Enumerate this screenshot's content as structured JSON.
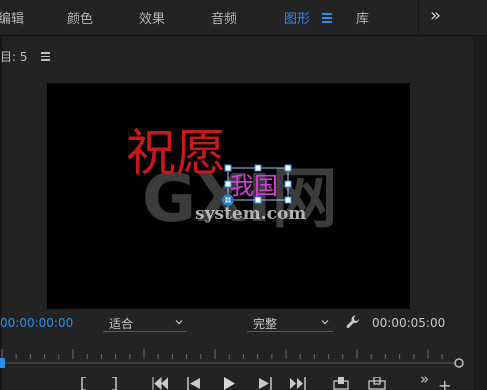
{
  "workspace_tabs": [
    {
      "label": "编辑",
      "active": false
    },
    {
      "label": "颜色",
      "active": false
    },
    {
      "label": "效果",
      "active": false
    },
    {
      "label": "音频",
      "active": false
    },
    {
      "label": "图形",
      "active": true
    },
    {
      "label": "库",
      "active": false
    }
  ],
  "panel": {
    "title": "目: 5"
  },
  "video": {
    "main_text": "祝愿",
    "sub_text": "我国",
    "watermark_logo": "GXI网",
    "watermark_text": "system.com"
  },
  "controls": {
    "current_timecode": "00:00:00:00",
    "fit_value": "适合",
    "quality_value": "完整",
    "duration_timecode": "00:00:05:00"
  },
  "colors": {
    "accent": "#2d8ceb",
    "main_text": "#c8181a",
    "selection": "#9ec7ff",
    "sub_text": "#d43fd8"
  }
}
